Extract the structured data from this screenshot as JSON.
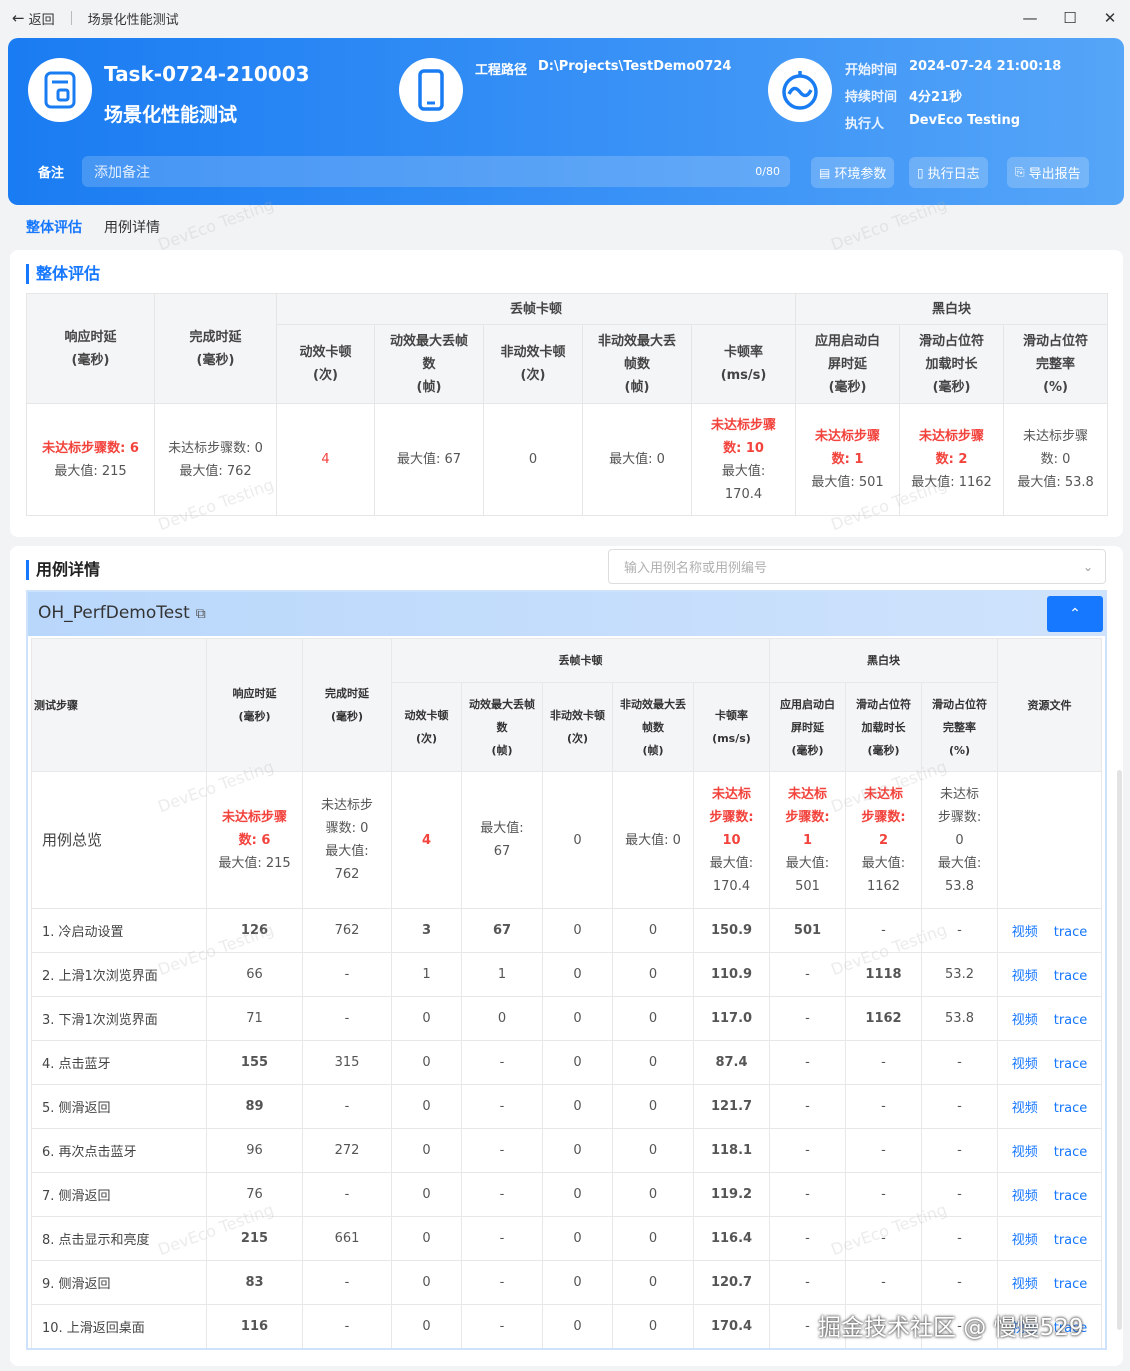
{
  "titlebar": {
    "back_label": "返回",
    "title": "场景化性能测试"
  },
  "header": {
    "task_id": "Task-0724-210003",
    "task_type": "场景化性能测试",
    "path_label": "工程路径",
    "path_value": "D:\\Projects\\TestDemo0724",
    "start_label": "开始时间",
    "start_value": "2024-07-24 21:00:18",
    "duration_label": "持续时间",
    "duration_value": "4分21秒",
    "executor_label": "执行人",
    "executor_value": "DevEco Testing",
    "remark_label": "备注",
    "remark_placeholder": "添加备注",
    "remark_count": "0/80",
    "btn_env": "环境参数",
    "btn_log": "执行日志",
    "btn_export": "导出报告"
  },
  "tabs": [
    {
      "label": "整体评估"
    },
    {
      "label": "用例详情"
    }
  ],
  "overview": {
    "title": "整体评估",
    "group_drop": "丢帧卡顿",
    "group_black": "黑白块",
    "h_resp": "响应时延",
    "h_resp_unit": "(毫秒)",
    "h_done": "完成时延",
    "h_done_unit": "(毫秒)",
    "h_anim": "动效卡顿",
    "h_anim_unit": "(次)",
    "h_anim_max_1": "动效最大丢帧",
    "h_anim_max_2": "数",
    "h_anim_max_unit": "(帧)",
    "h_nonanim": "非动效卡顿",
    "h_nonanim_unit": "(次)",
    "h_nonanim_max_1": "非动效最大丢",
    "h_nonanim_max_2": "帧数",
    "h_nonanim_max_unit": "(帧)",
    "h_rate": "卡顿率",
    "h_rate_unit": "(ms/s)",
    "h_launch_1": "应用启动白",
    "h_launch_2": "屏时延",
    "h_launch_unit": "(毫秒)",
    "h_slide_1": "滑动占位符",
    "h_slide_2": "加载时长",
    "h_slide_unit": "(毫秒)",
    "h_compl_1": "滑动占位符",
    "h_compl_2": "完整率",
    "h_compl_unit": "(%)",
    "resp_red": "未达标步骤数: 6",
    "resp_max": "最大值: 215",
    "done_l1": "未达标步骤数: 0",
    "done_max": "最大值: 762",
    "anim": "4",
    "anim_max": "最大值: 67",
    "nonanim": "0",
    "nonanim_max": "最大值: 0",
    "rate_red_1": "未达标步骤",
    "rate_red_2": "数: 10",
    "rate_max_1": "最大值:",
    "rate_max_2": "170.4",
    "launch_red_1": "未达标步骤",
    "launch_red_2": "数: 1",
    "launch_max": "最大值: 501",
    "slide_red_1": "未达标步骤",
    "slide_red_2": "数: 2",
    "slide_max": "最大值: 1162",
    "compl_1": "未达标步骤",
    "compl_2": "数: 0",
    "compl_max": "最大值: 53.8"
  },
  "cases": {
    "title": "用例详情",
    "search_placeholder": "输入用例名称或用例编号",
    "case_name": "OH_PerfDemoTest",
    "h_step": "测试步骤",
    "h_res": "资源文件",
    "summary": {
      "label": "用例总览",
      "resp_1": "未达标步骤",
      "resp_2": "数: 6",
      "resp_3": "最大值: 215",
      "done_1": "未达标步",
      "done_2": "骤数: 0",
      "done_3": "最大值:",
      "done_4": "762",
      "anim": "4",
      "anim_max_1": "最大值:",
      "anim_max_2": "67",
      "nonanim": "0",
      "nonanim_max": "最大值: 0",
      "rate_1": "未达标",
      "rate_2": "步骤数:",
      "rate_3": "10",
      "rate_4": "最大值:",
      "rate_5": "170.4",
      "launch_1": "未达标",
      "launch_2": "步骤数:",
      "launch_3": "1",
      "launch_4": "最大值:",
      "launch_5": "501",
      "slide_1": "未达标",
      "slide_2": "步骤数:",
      "slide_3": "2",
      "slide_4": "最大值:",
      "slide_5": "1162",
      "compl_1": "未达标",
      "compl_2": "步骤数:",
      "compl_3": "0",
      "compl_4": "最大值:",
      "compl_5": "53.8"
    },
    "link_video": "视频",
    "link_trace": "trace",
    "rows": [
      {
        "step": "1. 冷启动设置",
        "resp": "126",
        "resp_red": true,
        "done": "762",
        "anim": "3",
        "anim_red": true,
        "animmax": "67",
        "animmax_red": true,
        "non": "0",
        "nonmax": "0",
        "rate": "150.9",
        "launch": "501",
        "launch_red": true,
        "slide": "-",
        "slide_red": false,
        "compl": "-"
      },
      {
        "step": "2. 上滑1次浏览界面",
        "resp": "66",
        "resp_red": false,
        "done": "-",
        "anim": "1",
        "anim_red": false,
        "animmax": "1",
        "animmax_red": false,
        "non": "0",
        "nonmax": "0",
        "rate": "110.9",
        "launch": "-",
        "launch_red": false,
        "slide": "1118",
        "slide_red": true,
        "compl": "53.2"
      },
      {
        "step": "3. 下滑1次浏览界面",
        "resp": "71",
        "resp_red": false,
        "done": "-",
        "anim": "0",
        "anim_red": false,
        "animmax": "0",
        "animmax_red": false,
        "non": "0",
        "nonmax": "0",
        "rate": "117.0",
        "launch": "-",
        "launch_red": false,
        "slide": "1162",
        "slide_red": true,
        "compl": "53.8"
      },
      {
        "step": "4. 点击蓝牙",
        "resp": "155",
        "resp_red": true,
        "done": "315",
        "anim": "0",
        "anim_red": false,
        "animmax": "-",
        "animmax_red": false,
        "non": "0",
        "nonmax": "0",
        "rate": "87.4",
        "launch": "-",
        "launch_red": false,
        "slide": "-",
        "slide_red": false,
        "compl": "-"
      },
      {
        "step": "5. 侧滑返回",
        "resp": "89",
        "resp_red": true,
        "done": "-",
        "anim": "0",
        "anim_red": false,
        "animmax": "-",
        "animmax_red": false,
        "non": "0",
        "nonmax": "0",
        "rate": "121.7",
        "launch": "-",
        "launch_red": false,
        "slide": "-",
        "slide_red": false,
        "compl": "-"
      },
      {
        "step": "6. 再次点击蓝牙",
        "resp": "96",
        "resp_red": false,
        "done": "272",
        "anim": "0",
        "anim_red": false,
        "animmax": "-",
        "animmax_red": false,
        "non": "0",
        "nonmax": "0",
        "rate": "118.1",
        "launch": "-",
        "launch_red": false,
        "slide": "-",
        "slide_red": false,
        "compl": "-"
      },
      {
        "step": "7. 侧滑返回",
        "resp": "76",
        "resp_red": false,
        "done": "-",
        "anim": "0",
        "anim_red": false,
        "animmax": "-",
        "animmax_red": false,
        "non": "0",
        "nonmax": "0",
        "rate": "119.2",
        "launch": "-",
        "launch_red": false,
        "slide": "-",
        "slide_red": false,
        "compl": "-"
      },
      {
        "step": "8. 点击显示和亮度",
        "resp": "215",
        "resp_red": true,
        "done": "661",
        "anim": "0",
        "anim_red": false,
        "animmax": "-",
        "animmax_red": false,
        "non": "0",
        "nonmax": "0",
        "rate": "116.4",
        "launch": "-",
        "launch_red": false,
        "slide": "-",
        "slide_red": false,
        "compl": "-"
      },
      {
        "step": "9. 侧滑返回",
        "resp": "83",
        "resp_red": true,
        "done": "-",
        "anim": "0",
        "anim_red": false,
        "animmax": "-",
        "animmax_red": false,
        "non": "0",
        "nonmax": "0",
        "rate": "120.7",
        "launch": "-",
        "launch_red": false,
        "slide": "-",
        "slide_red": false,
        "compl": "-"
      },
      {
        "step": "10. 上滑返回桌面",
        "resp": "116",
        "resp_red": true,
        "done": "-",
        "anim": "0",
        "anim_red": false,
        "animmax": "-",
        "animmax_red": false,
        "non": "0",
        "nonmax": "0",
        "rate": "170.4",
        "launch": "-",
        "launch_red": false,
        "slide": "-",
        "slide_red": false,
        "compl": "-"
      }
    ]
  },
  "watermark_text": "DevEco Testing",
  "juejin": "掘金技术社区 @ 慢慢529",
  "colors": {
    "accent": "#1677ff",
    "red": "#f2433d",
    "header_blue": "#2a87f4"
  }
}
